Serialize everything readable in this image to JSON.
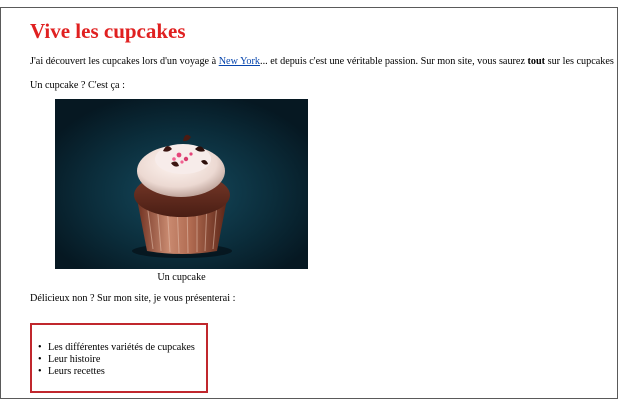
{
  "page": {
    "title": "Vive les cupcakes",
    "intro": {
      "before_link": "J'ai découvert les cupcakes lors d'un voyage à ",
      "link_text": "New York",
      "after_link": "... et depuis c'est une véritable passion. Sur mon site, vous saurez ",
      "bold_text": "tout",
      "after_bold": " sur les cupcakes !"
    },
    "question": "Un cupcake ? C'est ça :",
    "figure_caption": "Un cupcake",
    "lead": "Délicieux non ? Sur mon site, je vous présenterai :",
    "list_items": [
      "Les différentes variétés de cupcakes",
      "Leur histoire",
      "Leurs recettes"
    ],
    "bullet": "•"
  },
  "colors": {
    "title": "#e02020",
    "link": "#0645ad",
    "list_border": "#c0272d",
    "photo_background": "#0a2a38"
  }
}
